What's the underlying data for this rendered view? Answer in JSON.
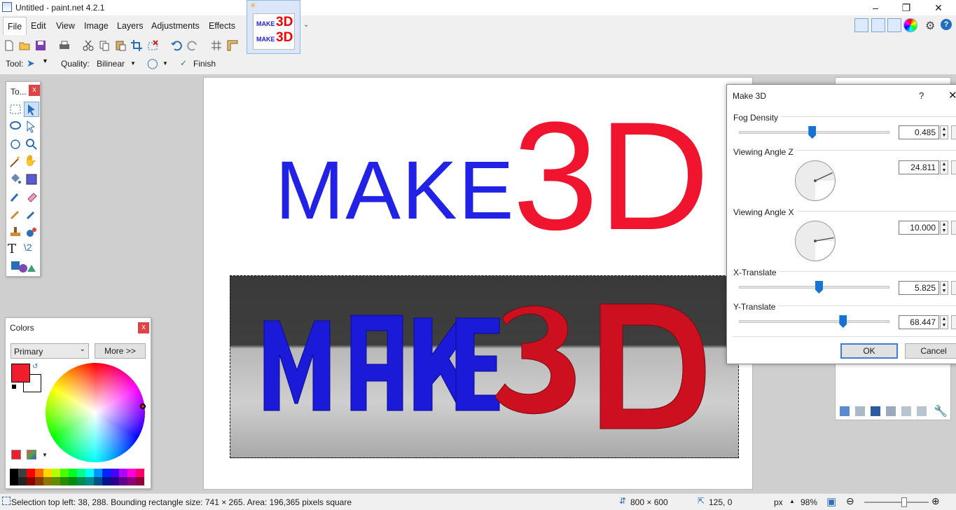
{
  "window": {
    "title": "Untitled - paint.net 4.2.1"
  },
  "menu": [
    "File",
    "Edit",
    "View",
    "Image",
    "Layers",
    "Adjustments",
    "Effects"
  ],
  "image_tab": {
    "thumb_line1": "MAKE",
    "thumb_line2": "3D"
  },
  "toolbar": {
    "tool_label": "Tool:",
    "quality_label": "Quality:",
    "quality_value": "Bilinear",
    "finish_label": "Finish"
  },
  "tools_panel": {
    "title": "To..."
  },
  "colors_panel": {
    "title": "Colors",
    "mode": "Primary",
    "more_button": "More >>",
    "primary_color": "#f01e2c",
    "secondary_color": "#ffffff"
  },
  "canvas_art": {
    "word": "MAKE",
    "big": "3D",
    "word_color": "#2222e6",
    "big_color": "#f0142e"
  },
  "dialog": {
    "title": "Make 3D",
    "help": "?",
    "fields": [
      {
        "label": "Fog Density",
        "value": "0.485",
        "slider_fraction": 0.485
      },
      {
        "label": "Viewing Angle Z",
        "value": "24.811",
        "angle_deg": 24.811
      },
      {
        "label": "Viewing Angle X",
        "value": "10.000",
        "angle_deg": 10.0
      },
      {
        "label": "X-Translate",
        "value": "5.825",
        "slider_fraction": 0.53
      },
      {
        "label": "Y-Translate",
        "value": "68.447",
        "slider_fraction": 0.69
      }
    ],
    "ok": "OK",
    "cancel": "Cancel"
  },
  "status": {
    "selection": "Selection top left: 38, 288. Bounding rectangle size: 741 × 265. Area: 196,365 pixels square",
    "image_size": "800 × 600",
    "cursor": "125, 0",
    "units": "px",
    "zoom": "98%",
    "zoom_fraction": 0.62
  },
  "palette": [
    "#000000",
    "#404040",
    "#ff0000",
    "#ff6a00",
    "#ffd800",
    "#b6ff00",
    "#4cff00",
    "#00ff21",
    "#00ff90",
    "#00ffff",
    "#0094ff",
    "#0026ff",
    "#4800ff",
    "#b200ff",
    "#ff00dc",
    "#ff006e"
  ]
}
